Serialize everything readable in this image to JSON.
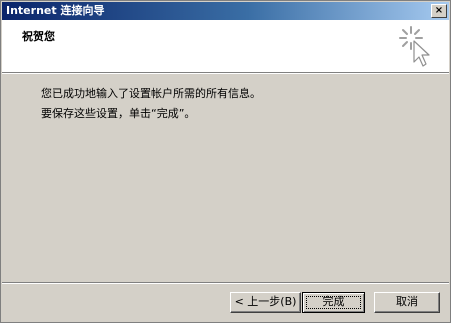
{
  "window": {
    "title": "Internet 连接向导",
    "close_label": "×"
  },
  "header": {
    "title": "祝贺您",
    "icon": "wizard-sparkle-cursor-icon"
  },
  "body": {
    "line1": "您已成功地输入了设置帐户所需的所有信息。",
    "line2": "要保存这些设置，单击“完成”。"
  },
  "buttons": {
    "back_label": "< 上一步(B)",
    "finish_label": "完成",
    "cancel_label": "取消"
  },
  "colors": {
    "titlebar_start": "#0a246a",
    "titlebar_end": "#a6caf0",
    "dialog_face": "#d4d0c8"
  }
}
